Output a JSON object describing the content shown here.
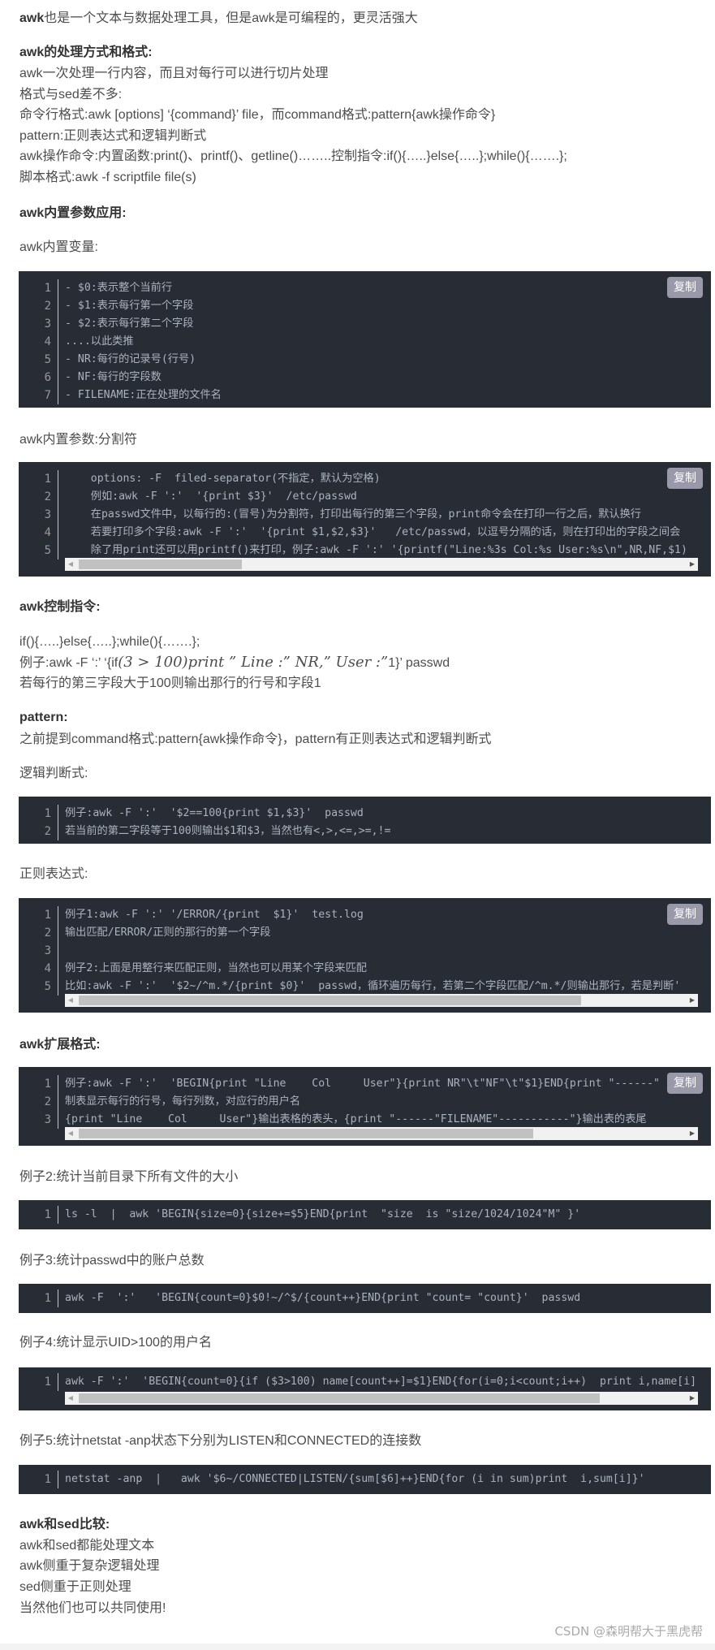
{
  "intro": {
    "bold": "awk",
    "rest": "也是一个文本与数据处理工具，但是awk是可编程的，更灵活强大"
  },
  "section_format": {
    "heading": "awk的处理方式和格式:",
    "lines": [
      "awk一次处理一行内容，而且对每行可以进行切片处理",
      "格式与sed差不多:",
      "命令行格式:awk [options] ‘{command}’ file，而command格式:pattern{awk操作命令}",
      "pattern:正则表达式和逻辑判断式",
      "awk操作命令:内置函数:print()、printf()、getline()……..控制指令:if(){…..}else{…..};while(){…….};",
      "脚本格式:awk -f scriptfile file(s)"
    ]
  },
  "section_builtin": {
    "heading": "awk内置参数应用:",
    "vars_label": "awk内置变量:",
    "vars_code": {
      "copy_label": "复制",
      "lines": [
        "- $0:表示整个当前行",
        "- $1:表示每行第一个字段",
        "- $2:表示每行第二个字段",
        "....以此类推",
        "- NR:每行的记录号(行号)",
        "- NF:每行的字段数",
        "- FILENAME:正在处理的文件名"
      ]
    },
    "sep_label": "awk内置参数:分割符",
    "sep_code": {
      "copy_label": "复制",
      "scroll_thumb_fraction": 0.27,
      "lines": [
        "    options: -F  filed-separator(不指定，默认为空格)",
        "    例如:awk -F ':'  '{print $3}'  /etc/passwd",
        "    在passwd文件中，以每行的:(冒号)为分割符，打印出每行的第三个字段，print命令会在打印一行之后，默认换行",
        "    若要打印多个字段:awk -F ':'  '{print $1,$2,$3}'   /etc/passwd，以逗号分隔的话，则在打印出的字段之间会",
        "    除了用print还可以用printf()来打印，例子:awk -F ':' '{printf(\"Line:%3s Col:%s User:%s\\n\",NR,NF,$1)"
      ]
    }
  },
  "section_control": {
    "heading": "awk控制指令:",
    "syntax": "if(){…..}else{…..};while(){…….};",
    "example_prefix": "例子:awk -F ‘:’ ‘{if",
    "example_math": "(3 > 100)print ” Line :” NR,” User :”",
    "example_suffix": "1}’ passwd",
    "explain": "若每行的第三字段大于100则输出那行的行号和字段1"
  },
  "section_pattern": {
    "heading": "pattern:",
    "desc": "之前提到command格式:pattern{awk操作命令}，pattern有正则表达式和逻辑判断式",
    "logic_label": "逻辑判断式:",
    "logic_code": {
      "lines": [
        "例子:awk -F ':'  '$2==100{print $1,$3}'  passwd",
        "若当前的第二字段等于100则输出$1和$3，当然也有<,>,<=,>=,!="
      ]
    },
    "regex_label": "正则表达式:",
    "regex_code": {
      "copy_label": "复制",
      "scroll_thumb_fraction": 0.83,
      "lines": [
        "例子1:awk -F ':' '/ERROR/{print  $1}'  test.log",
        "输出匹配/ERROR/正则的那行的第一个字段",
        "",
        "例子2:上面是用整行来匹配正则，当然也可以用某个字段来匹配",
        "比如:awk -F ':'  '$2~/^m.*/{print $0}'  passwd，循环遍历每行，若第二个字段匹配/^m.*/则输出那行，若是判断'"
      ]
    }
  },
  "section_extended": {
    "heading": "awk扩展格式:",
    "ext_code": {
      "copy_label": "复制",
      "scroll_thumb_fraction": 0.75,
      "lines": [
        "例子:awk -F ':'  'BEGIN{print \"Line    Col     User\"}{print NR\"\\t\"NF\"\\t\"$1}END{print \"------\"",
        "制表显示每行的行号，每行列数，对应行的用户名",
        "{print \"Line    Col     User\"}输出表格的表头，{print \"------\"FILENAME\"-----------\"}输出表的表尾"
      ]
    },
    "ex2_label": "例子2:统计当前目录下所有文件的大小",
    "ex2_code": {
      "lines": [
        "ls -l  |  awk 'BEGIN{size=0}{size+=$5}END{print  \"size  is \"size/1024/1024\"M\" }'"
      ]
    },
    "ex3_label": "例子3:统计passwd中的账户总数",
    "ex3_code": {
      "lines": [
        "awk -F  ':'   'BEGIN{count=0}$0!~/^$/{count++}END{print \"count= \"count}'  passwd"
      ]
    },
    "ex4_label": "例子4:统计显示UID>100的用户名",
    "ex4_code": {
      "scroll_thumb_fraction": 0.86,
      "lines": [
        "awk -F ':'  'BEGIN{count=0}{if ($3>100) name[count++]=$1}END{for(i=0;i<count;i++)  print i,name[i]"
      ]
    },
    "ex5_label": "例子5:统计netstat -anp状态下分别为LISTEN和CONNECTED的连接数",
    "ex5_code": {
      "lines": [
        "netstat -anp  |   awk '$6~/CONNECTED|LISTEN/{sum[$6]++}END{for (i in sum)print  i,sum[i]}'"
      ]
    }
  },
  "section_compare": {
    "heading": "awk和sed比较:",
    "lines": [
      "awk和sed都能处理文本",
      "awk侧重于复杂逻辑处理",
      "sed侧重于正则处理",
      "当然他们也可以共同使用!"
    ]
  },
  "watermark": "CSDN @森明帮大于黑虎帮",
  "colors": {
    "text": "#4d4d4d",
    "code_bg": "#282c34",
    "code_text": "#abb2bf",
    "copy_btn_bg": "#9999aa"
  }
}
